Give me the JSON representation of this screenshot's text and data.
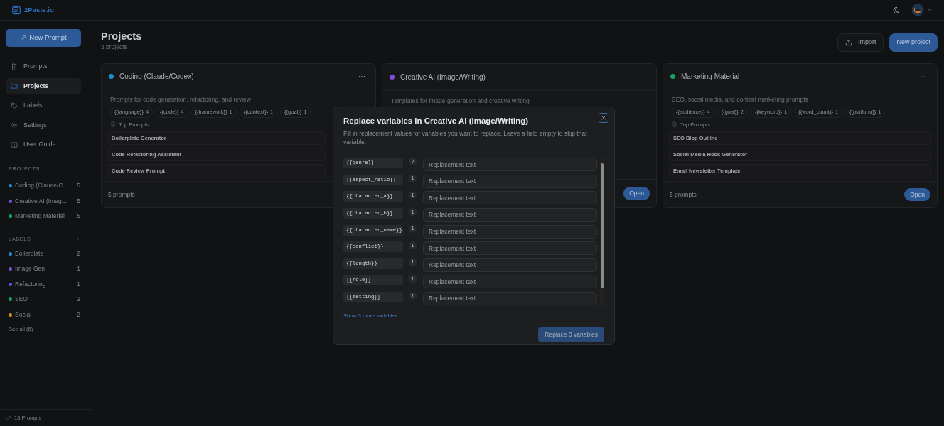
{
  "app": {
    "logo": "2Paste.io"
  },
  "sidebar": {
    "new_prompt": "New Prompt",
    "nav": [
      {
        "label": "Prompts",
        "selected": false
      },
      {
        "label": "Projects",
        "selected": true
      },
      {
        "label": "Labels",
        "selected": false
      },
      {
        "label": "Settings",
        "selected": false
      },
      {
        "label": "User Guide",
        "selected": false
      }
    ],
    "projects_heading": "PROJECTS",
    "projects": [
      {
        "name": "Coding (Claude/C...",
        "count": "5",
        "color": "#1a8fd0"
      },
      {
        "name": "Creative AI (Imag...",
        "count": "5",
        "color": "#7c4ddc"
      },
      {
        "name": "Marketing Material",
        "count": "5",
        "color": "#13a36b"
      }
    ],
    "labels_heading": "LABELS",
    "labels": [
      {
        "name": "Boilerplate",
        "count": "2",
        "color": "#1a8fd0"
      },
      {
        "name": "Image Gen",
        "count": "1",
        "color": "#7c4ddc"
      },
      {
        "name": "Refactoring",
        "count": "1",
        "color": "#5a55e0"
      },
      {
        "name": "SEO",
        "count": "2",
        "color": "#13a36b"
      },
      {
        "name": "Social",
        "count": "2",
        "color": "#d4900e"
      }
    ],
    "see_all": "See all (6)",
    "footer": "18 Prompts"
  },
  "page": {
    "title": "Projects",
    "subtitle": "3 projects",
    "import": "Import",
    "new_project": "New project"
  },
  "cards": [
    {
      "title": "Coding (Claude/Codex)",
      "color": "#1a8fd0",
      "menu": "···",
      "description": "Prompts for code generation, refactoring, and review",
      "chips": [
        {
          "name": "{{language}}",
          "count": "4"
        },
        {
          "name": "{{code}}",
          "count": "4"
        },
        {
          "name": "{{framework}}",
          "count": "1"
        },
        {
          "name": "{{context}}",
          "count": "1"
        },
        {
          "name": "{{goal}}",
          "count": "1"
        }
      ],
      "top_label": "Top Prompts",
      "prompts": [
        "Boilerplate Generator",
        "Code Refactoring Assistant",
        "Code Review Prompt"
      ],
      "footer": "5 prompts"
    },
    {
      "title": "Creative AI (Image/Writing)",
      "color": "#7c4ddc",
      "menu": "···",
      "description": "Templates for image generation and creative writing",
      "open": "Open"
    },
    {
      "title": "Marketing Material",
      "color": "#13a36b",
      "menu": "···",
      "description": "SEO, social media, and content marketing prompts",
      "chips": [
        {
          "name": "{{audience}}",
          "count": "4"
        },
        {
          "name": "{{goal}}",
          "count": "2"
        },
        {
          "name": "{{keyword}}",
          "count": "1"
        },
        {
          "name": "{{word_count}}",
          "count": "1"
        },
        {
          "name": "{{platform}}",
          "count": "1"
        }
      ],
      "top_label": "Top Prompts",
      "prompts": [
        "SEO Blog Outline",
        "Social Media Hook Generator",
        "Email Newsletter Template"
      ],
      "footer": "5 prompts",
      "open": "Open"
    }
  ],
  "modal": {
    "title": "Replace variables in Creative AI (Image/Writing)",
    "description": "Fill in replacement values for variables you want to replace. Leave a field empty to skip that variable.",
    "variables": [
      {
        "name": "{{genre}}",
        "count": "2",
        "placeholder": "Replacement text"
      },
      {
        "name": "{{aspect_ratio}}",
        "count": "1",
        "placeholder": "Replacement text"
      },
      {
        "name": "{{character_a}}",
        "count": "1",
        "placeholder": "Replacement text"
      },
      {
        "name": "{{character_b}}",
        "count": "1",
        "placeholder": "Replacement text"
      },
      {
        "name": "{{character_name}}",
        "count": "1",
        "placeholder": "Replacement text"
      },
      {
        "name": "{{conflict}}",
        "count": "1",
        "placeholder": "Replacement text"
      },
      {
        "name": "{{length}}",
        "count": "1",
        "placeholder": "Replacement text"
      },
      {
        "name": "{{role}}",
        "count": "1",
        "placeholder": "Replacement text"
      },
      {
        "name": "{{setting}}",
        "count": "1",
        "placeholder": "Replacement text"
      }
    ],
    "show_more": "Show 3 more variables",
    "submit": "Replace 0 variables",
    "submit_disabled": true
  }
}
